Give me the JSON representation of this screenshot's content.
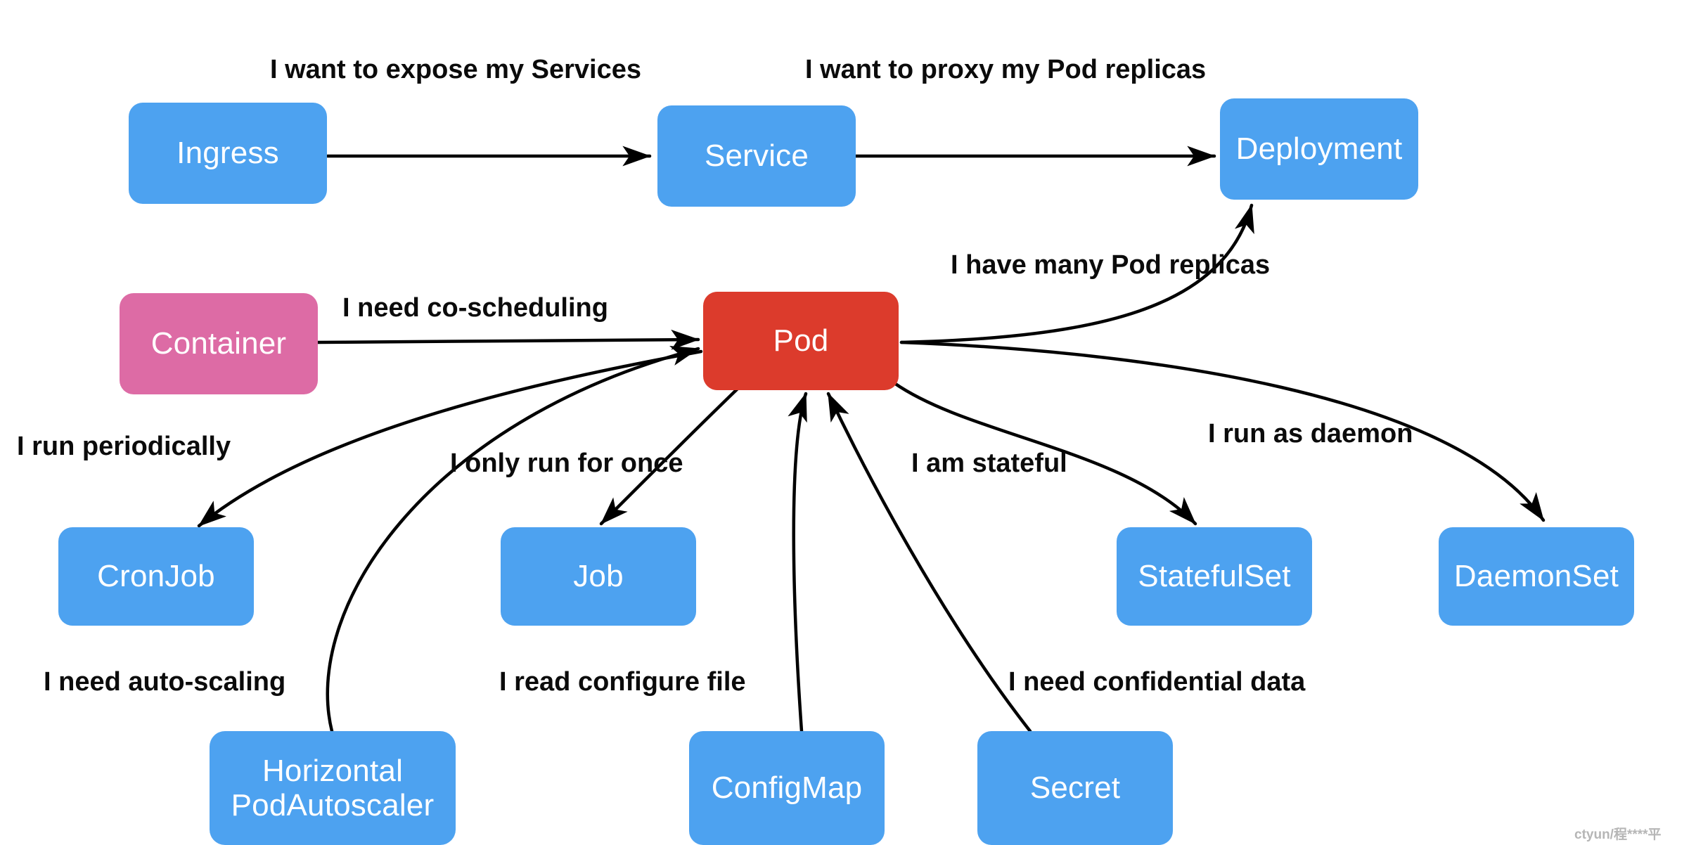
{
  "diagram": {
    "title": "Kubernetes object relationships",
    "colors": {
      "blue": "#4da2f0",
      "red": "#dc3b2c",
      "pink": "#dd6ba5",
      "edge": "#000000",
      "label_text": "#0b0b0b",
      "background": "#ffffff",
      "watermark": "#b6b6b6"
    },
    "nodes": [
      {
        "id": "ingress",
        "label": "Ingress",
        "color": "blue"
      },
      {
        "id": "service",
        "label": "Service",
        "color": "blue"
      },
      {
        "id": "deployment",
        "label": "Deployment",
        "color": "blue"
      },
      {
        "id": "container",
        "label": "Container",
        "color": "pink"
      },
      {
        "id": "pod",
        "label": "Pod",
        "color": "red"
      },
      {
        "id": "cronjob",
        "label": "CronJob",
        "color": "blue"
      },
      {
        "id": "job",
        "label": "Job",
        "color": "blue"
      },
      {
        "id": "statefulset",
        "label": "StatefulSet",
        "color": "blue"
      },
      {
        "id": "daemonset",
        "label": "DaemonSet",
        "color": "blue"
      },
      {
        "id": "hpa",
        "label": "Horizontal\nPodAutoscaler",
        "color": "blue"
      },
      {
        "id": "configmap",
        "label": "ConfigMap",
        "color": "blue"
      },
      {
        "id": "secret",
        "label": "Secret",
        "color": "blue"
      }
    ],
    "edge_labels": [
      {
        "id": "expose",
        "text": "I want to expose my Services"
      },
      {
        "id": "proxy",
        "text": "I want to proxy my Pod replicas"
      },
      {
        "id": "replicas",
        "text": "I have many Pod replicas"
      },
      {
        "id": "coschedule",
        "text": "I need co-scheduling"
      },
      {
        "id": "periodic",
        "text": "I run periodically"
      },
      {
        "id": "runonce",
        "text": "I only run for once"
      },
      {
        "id": "stateful",
        "text": "I am stateful"
      },
      {
        "id": "daemon",
        "text": "I run as daemon"
      },
      {
        "id": "autoscaling",
        "text": "I need auto-scaling"
      },
      {
        "id": "configfile",
        "text": "I read configure file"
      },
      {
        "id": "confidential",
        "text": "I need confidential data"
      }
    ],
    "watermark": {
      "text": "ctyun/程****平"
    }
  }
}
